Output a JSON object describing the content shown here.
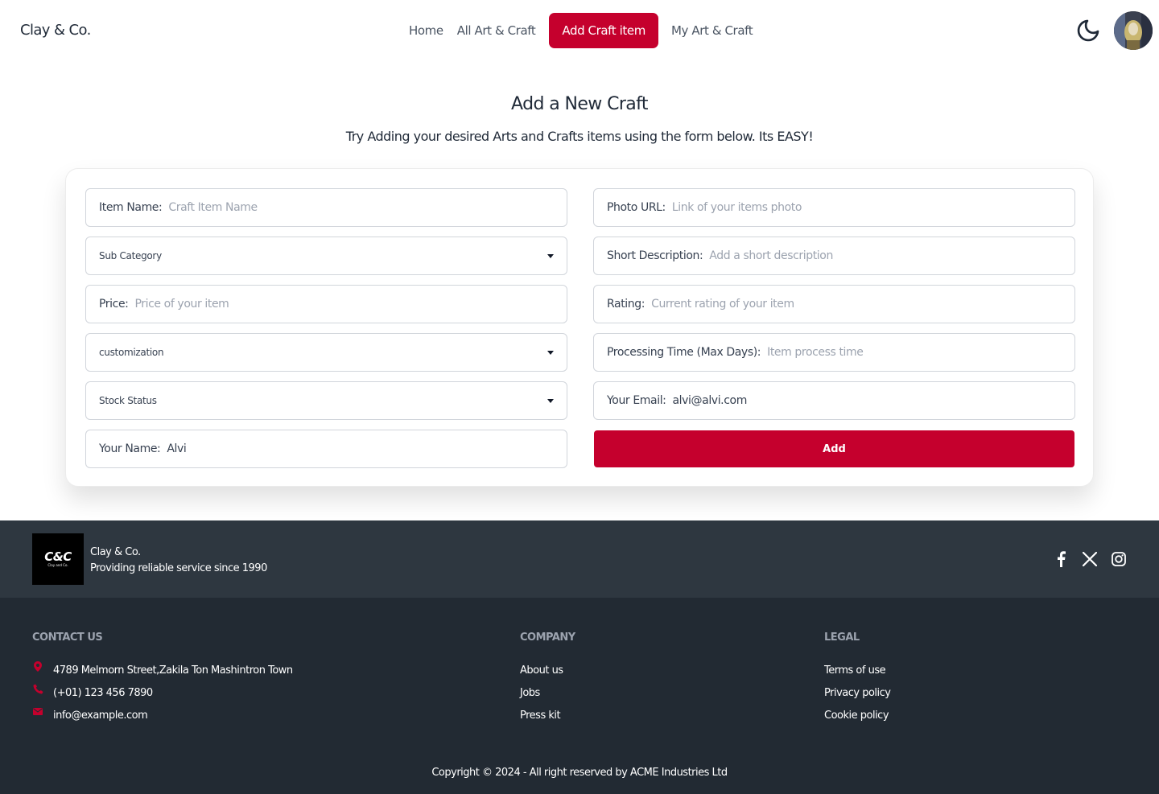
{
  "nav": {
    "brand": "Clay & Co.",
    "links": [
      {
        "label": "Home",
        "active": false
      },
      {
        "label": "All Art & Craft",
        "active": false
      },
      {
        "label": "Add Craft item",
        "active": true
      },
      {
        "label": "My Art & Craft",
        "active": false
      }
    ],
    "theme_icon": "moon-icon",
    "avatar_icon": "user-avatar"
  },
  "header": {
    "title": "Add a New Craft",
    "subtitle": "Try Adding your desired Arts and Crafts items using the form below. Its EASY!"
  },
  "form": {
    "item_name": {
      "label": "Item Name:",
      "placeholder": "Craft Item Name",
      "value": ""
    },
    "sub_category": {
      "selected": "Sub Category"
    },
    "price": {
      "label": "Price:",
      "placeholder": "Price of your item",
      "value": ""
    },
    "customization": {
      "selected": "customization"
    },
    "stock_status": {
      "selected": "Stock Status"
    },
    "your_name": {
      "label": "Your Name:",
      "value": "Alvi"
    },
    "photo_url": {
      "label": "Photo URL:",
      "placeholder": "Link of your items photo",
      "value": ""
    },
    "short_description": {
      "label": "Short Description:",
      "placeholder": "Add a short description",
      "value": ""
    },
    "rating": {
      "label": "Rating:",
      "placeholder": "Current rating of your item",
      "value": ""
    },
    "processing_time": {
      "label": "Processing Time (Max Days):",
      "placeholder": "Item process time",
      "value": ""
    },
    "your_email": {
      "label": "Your Email:",
      "value": "alvi@alvi.com"
    },
    "submit_label": "Add"
  },
  "footer": {
    "logo_text": "C&C",
    "logo_subtext": "Clay and Co.",
    "brand_name": "Clay & Co.",
    "tagline": "Providing reliable service since 1990",
    "social": [
      "facebook-icon",
      "x-icon",
      "instagram-icon"
    ],
    "contact": {
      "heading": "CONTACT US",
      "address": "4789 Melmorn Street,Zakila Ton Mashintron Town",
      "phone": "(+01) 123 456 7890",
      "email": "info@example.com"
    },
    "company": {
      "heading": "COMPANY",
      "links": [
        "About us",
        "Jobs",
        "Press kit"
      ]
    },
    "legal": {
      "heading": "LEGAL",
      "links": [
        "Terms of use",
        "Privacy policy",
        "Cookie policy"
      ]
    },
    "copyright": "Copyright © 2024 - All right reserved by ACME Industries Ltd"
  },
  "colors": {
    "accent": "#c5002d",
    "footer_top_bg": "#2e3740",
    "footer_bottom_bg": "#222a33"
  }
}
